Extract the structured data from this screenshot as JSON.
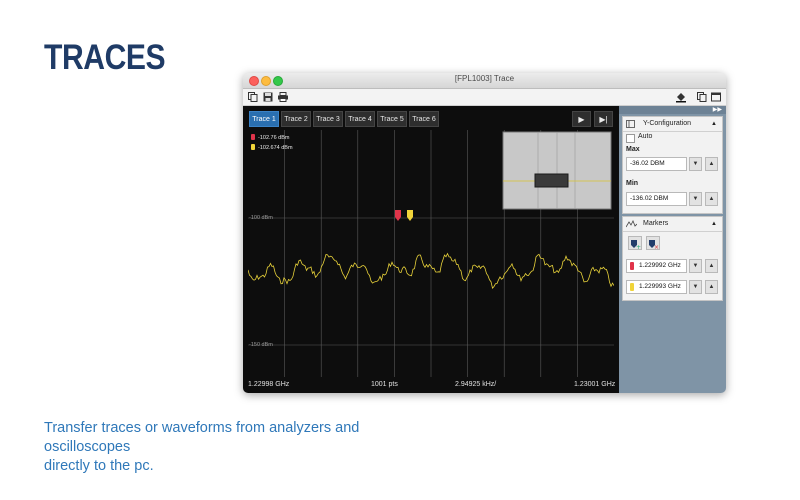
{
  "heading": "TRACES",
  "caption_line1": "Transfer traces or waveforms from analyzers and oscilloscopes",
  "caption_line2": "directly to the pc.",
  "window": {
    "title": "[FPL1003] Trace",
    "traffic_lights": [
      "close",
      "minimize",
      "zoom"
    ]
  },
  "toolbar": {
    "left_icons": [
      "copy-icon",
      "save-icon",
      "print-icon"
    ],
    "right_icons": [
      "paint-bucket-icon",
      "duplicate-icon",
      "window-icon"
    ]
  },
  "tabs": [
    {
      "label": "Trace 1",
      "active": true
    },
    {
      "label": "Trace 2",
      "active": false
    },
    {
      "label": "Trace 3",
      "active": false
    },
    {
      "label": "Trace 4",
      "active": false
    },
    {
      "label": "Trace 5",
      "active": false
    },
    {
      "label": "Trace 6",
      "active": false
    }
  ],
  "controls": {
    "play_icon": "play-icon",
    "step_icon": "step-forward-icon"
  },
  "plot": {
    "marker_readouts": [
      {
        "value": "-102.76 dBm",
        "color": "#e0344a"
      },
      {
        "value": "-102.674 dBm",
        "color": "#f0d43a"
      }
    ],
    "y_labels": {
      "upper": "-100 dBm",
      "lower": "-150 dBm"
    },
    "trace_color": "#e8d23a",
    "grid_color": "#5a5a5a"
  },
  "footer": {
    "start": "1.22998 GHz",
    "points": "1001 pts",
    "span": "2.94925 kHz/",
    "stop": "1.23001 GHz"
  },
  "sidebar": {
    "y_config": {
      "title": "Y-Configuration",
      "auto_label": "Auto",
      "auto_checked": false,
      "max_label": "Max",
      "max_value": "-36.02 DBM",
      "min_label": "Min",
      "min_value": "-136.02 DBM"
    },
    "markers": {
      "title": "Markers",
      "items": [
        {
          "value": "1.229992 GHz",
          "color": "#e0344a"
        },
        {
          "value": "1.229993 GHz",
          "color": "#f0d43a"
        }
      ]
    }
  },
  "glyphs": {
    "down": "▼",
    "up": "▲",
    "play": "▶",
    "step": "▶|",
    "collapse": "▲",
    "sidebar_toggle": "▶▶"
  }
}
